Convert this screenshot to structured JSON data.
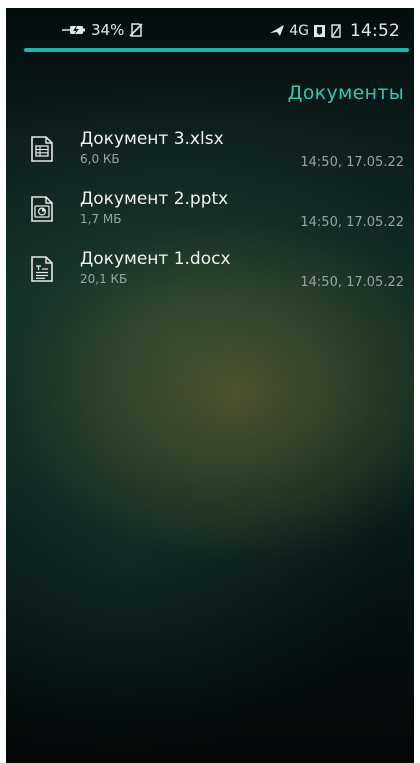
{
  "status_bar": {
    "battery_percent": "34%",
    "network_type": "4G",
    "time": "14:52",
    "icons": [
      "charging-icon",
      "no-sim-icon",
      "airplane-icon",
      "signal-icon",
      "no-signal-icon"
    ]
  },
  "colors": {
    "accent": "#21b5a3",
    "title": "#2fc7b7"
  },
  "page": {
    "title": "Документы"
  },
  "files": [
    {
      "name": "Документ 3.xlsx",
      "size": "6,0 КБ",
      "modified": "14:50, 17.05.22",
      "icon": "spreadsheet-icon"
    },
    {
      "name": "Документ 2.pptx",
      "size": "1,7 МБ",
      "modified": "14:50, 17.05.22",
      "icon": "presentation-icon"
    },
    {
      "name": "Документ 1.docx",
      "size": "20,1 КБ",
      "modified": "14:50, 17.05.22",
      "icon": "text-document-icon"
    }
  ]
}
